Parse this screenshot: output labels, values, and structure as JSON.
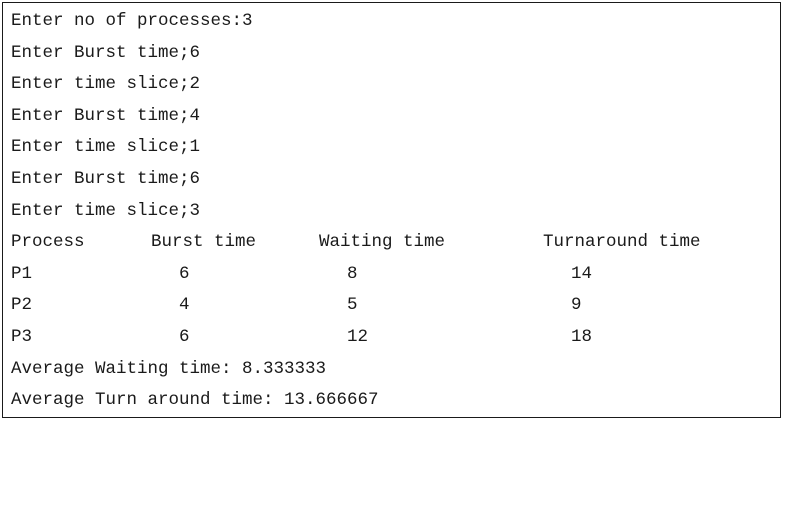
{
  "console": {
    "input_lines": [
      "Enter no of processes:3",
      "Enter Burst time;6",
      "Enter time slice;2",
      "Enter Burst time;4",
      "Enter time slice;1",
      "Enter Burst time;6",
      "Enter time slice;3"
    ],
    "table": {
      "headers": [
        "Process",
        "Burst time",
        "Waiting time",
        "Turnaround time"
      ],
      "rows": [
        {
          "process": "P1",
          "burst": "6",
          "waiting": "8",
          "turnaround": "14"
        },
        {
          "process": "P2",
          "burst": "4",
          "waiting": "5",
          "turnaround": "9"
        },
        {
          "process": "P3",
          "burst": "6",
          "waiting": "12",
          "turnaround": "18"
        }
      ]
    },
    "summary": {
      "avg_waiting": "Average Waiting time: 8.333333",
      "avg_turnaround": "Average Turn around time: 13.666667"
    }
  }
}
